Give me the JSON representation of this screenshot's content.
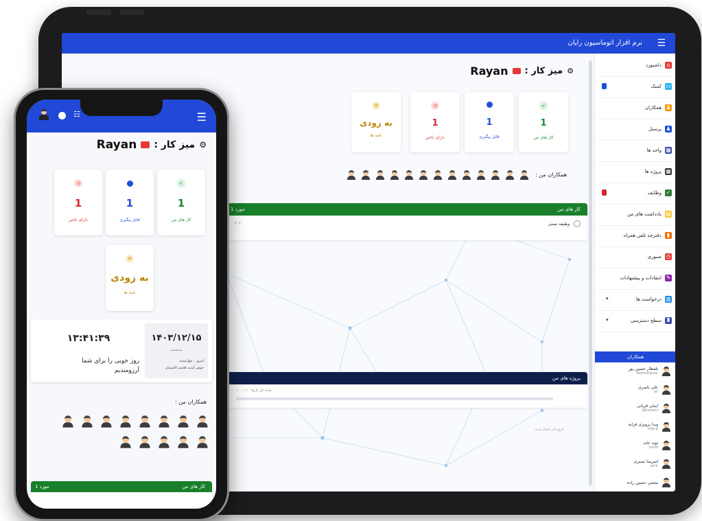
{
  "tablet": {
    "app_title": "نرم افزار اتوماسیون رایان",
    "heading": {
      "label": "میز کار :",
      "user": "Rayan"
    },
    "stats": [
      {
        "value": "1",
        "label": "کار های من",
        "color": "#1a8a3a",
        "dot": "#d9f2de"
      },
      {
        "value": "1",
        "label": "قابل پیگیری",
        "color": "#1f4fd8",
        "dot": "#1f4fd8"
      },
      {
        "value": "1",
        "label": "دارای تاخیر",
        "color": "#d6282c",
        "dot": "#fde0dc"
      },
      {
        "value": "به زودی",
        "label": "نامه ها",
        "color": "#b8860b",
        "dot": "#fcefc8"
      }
    ],
    "colleagues_label": "همکاران من :",
    "tasks_panel": {
      "title": "کار های من",
      "left_text": "1 مورد",
      "item": "وظیفه تستی",
      "item_date": "۱۴۰۳"
    },
    "projects_panel": {
      "title": "پروژه های من",
      "row_text": "۱۰ تعداد کل کارها : ۱ / ۰",
      "empty_text": "تاریخ آخر انجام شده"
    },
    "sidebar": {
      "items": [
        {
          "label": "داشبورد",
          "icon": "home-icon",
          "color": "#e53935"
        },
        {
          "label": "کمتک",
          "icon": "chat-icon",
          "color": "#29b6f6",
          "badge": "#1f4fd8"
        },
        {
          "label": "همکاران",
          "icon": "users-icon",
          "color": "#ff9800"
        },
        {
          "label": "پرسنل",
          "icon": "people-icon",
          "color": "#1f4fd8"
        },
        {
          "label": "واحد ها",
          "icon": "org-icon",
          "color": "#3949ab"
        },
        {
          "label": "پروژه ها",
          "icon": "qr-icon",
          "color": "#333333"
        },
        {
          "label": "وظایف",
          "icon": "check-icon",
          "color": "#2e7d32",
          "badge": "#d6282c"
        },
        {
          "label": "یادداشت های من",
          "icon": "note-icon",
          "color": "#fbc02d"
        },
        {
          "label": "دفترچه تلفن همراه",
          "icon": "book-icon",
          "color": "#ef6c00"
        },
        {
          "label": "صنوری",
          "icon": "clock-icon",
          "color": "#e53935"
        },
        {
          "label": "انتقادات و پیشنهادات",
          "icon": "feedback-icon",
          "color": "#8e24aa"
        },
        {
          "label": "درخواست ها",
          "icon": "building-icon",
          "color": "#1e88e5",
          "arrow": "▾"
        },
        {
          "label": "سطح دسترسی",
          "icon": "access-icon",
          "color": "#3949ab",
          "arrow": "▾"
        }
      ],
      "online_title": "همکاران",
      "online_users": [
        {
          "name": "تلفظار حسین پور",
          "sub": "Asemanpoor"
        },
        {
          "name": "علی ناصری",
          "sub": "ali"
        },
        {
          "name": "ایمان قربانی",
          "sub": "ighorbani"
        },
        {
          "name": "ویدا پرویزی فرایه",
          "sub": "vida.p"
        },
        {
          "name": "نوید عابد",
          "sub": "navid"
        },
        {
          "name": "امیرضا نصیری",
          "sub": "amir"
        },
        {
          "name": "مجتبی حسین زاده",
          "sub": ""
        }
      ]
    }
  },
  "phone": {
    "heading": {
      "label": "میز کار :",
      "user": "Rayan"
    },
    "stats": [
      {
        "value": "1",
        "label": "کار های من",
        "color": "#1a8a3a",
        "dot": "#d9f2de"
      },
      {
        "value": "1",
        "label": "قابل پیگیری",
        "color": "#1f4fd8",
        "dot": "#1f4fd8"
      },
      {
        "value": "1",
        "label": "دارای تاخیر",
        "color": "#d6282c",
        "dot": "#fde0dc"
      },
      {
        "value": "به زودی",
        "label": "نامه ها",
        "color": "#b8860b",
        "dot": "#fcefc8"
      }
    ],
    "date": "۱۴۰۳/۱۲/۱۵",
    "time": "۱۳:۴۱:۳۹",
    "date_sub": "سه‌شنبه",
    "today_line1": "امروز : چهارشنبه",
    "today_line2": "خوش آمدید قاسم کاشمیان",
    "greeting_line1": "روز خوبی را برای شما",
    "greeting_line2": "آرزومندیم",
    "colleagues_label": "همکاران من :",
    "tasks_title": "کار های من",
    "tasks_left": "1 مورد"
  }
}
